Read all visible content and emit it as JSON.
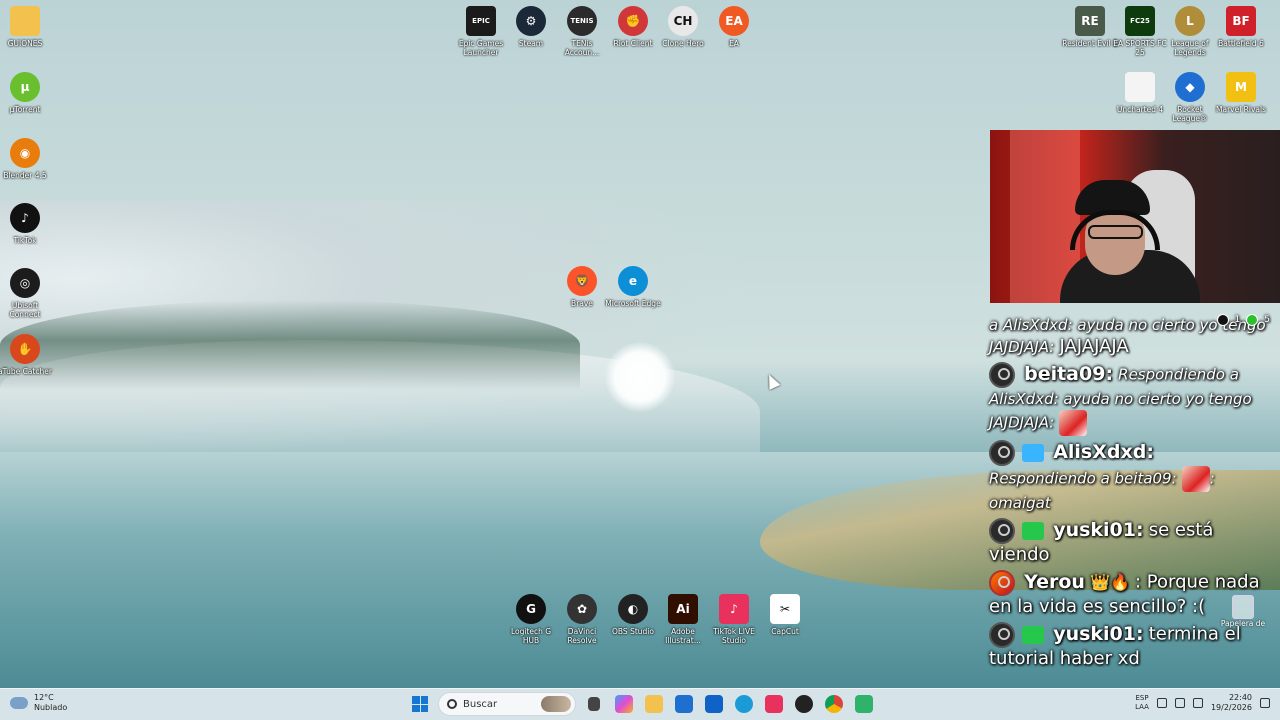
{
  "desktop": {
    "left_icons": [
      {
        "name": "guiones-folder-icon",
        "label": "GUIONES",
        "color": "#f2c14e",
        "glyph": ""
      },
      {
        "name": "utorrent-icon",
        "label": "µTorrent",
        "color": "#6abf2f",
        "glyph": "µ"
      },
      {
        "name": "blender-icon",
        "label": "Blender 4.5",
        "color": "#e87d0d",
        "glyph": "◉"
      },
      {
        "name": "tiktok-icon",
        "label": "TikTok",
        "color": "#111111",
        "glyph": "♪"
      },
      {
        "name": "ubisoft-connect-icon",
        "label": "Ubisoft Connect",
        "color": "#1c1c1c",
        "glyph": "◎"
      },
      {
        "name": "atube-catcher-icon",
        "label": "aTube Catcher",
        "color": "#d9481c",
        "glyph": "✋"
      }
    ],
    "top_icons": [
      {
        "name": "epic-games-icon",
        "label": "Epic Games Launcher",
        "color": "#1b1b1b",
        "glyph": "EPIC"
      },
      {
        "name": "steam-icon",
        "label": "Steam",
        "color": "#1b2838",
        "glyph": "⚙"
      },
      {
        "name": "tenis-icon",
        "label": "TENis Accoun...",
        "color": "#2b2b2b",
        "glyph": "TENIS"
      },
      {
        "name": "riot-client-icon",
        "label": "Riot Client",
        "color": "#d13639",
        "glyph": "✊"
      },
      {
        "name": "clone-hero-icon",
        "label": "Clone Hero",
        "color": "#e8e8e8",
        "glyph": "CH"
      },
      {
        "name": "ea-icon",
        "label": "EA",
        "color": "#f05a22",
        "glyph": "EA"
      }
    ],
    "right_icons": [
      {
        "name": "resident-evil-icon",
        "label": "Resident Evil 2",
        "color": "#4a5a4a",
        "glyph": "RE"
      },
      {
        "name": "ea-sports-fc-icon",
        "label": "EA SPORTS FC 25",
        "color": "#0d3b0d",
        "glyph": "FC25"
      },
      {
        "name": "league-of-legends-icon",
        "label": "League of Legends",
        "color": "#b08d3a",
        "glyph": "L"
      },
      {
        "name": "battlefield-icon",
        "label": "Battlefield 6",
        "color": "#d0202a",
        "glyph": "BF"
      },
      {
        "name": "uncharted-file-icon",
        "label": "Uncharted 4",
        "color": "#f4f4f4",
        "glyph": ""
      },
      {
        "name": "rocket-league-icon",
        "label": "Rocket League®",
        "color": "#1e6fd1",
        "glyph": "◆"
      },
      {
        "name": "marvel-rivals-icon",
        "label": "Marvel Rivals",
        "color": "#f2c012",
        "glyph": "M"
      }
    ],
    "middle_icons": [
      {
        "name": "brave-icon",
        "label": "Brave",
        "color": "#fb542b",
        "glyph": "🦁"
      },
      {
        "name": "microsoft-edge-icon",
        "label": "Microsoft Edge",
        "color": "#0c8fd6",
        "glyph": "e"
      }
    ],
    "bottom_icons": [
      {
        "name": "logitech-ghub-icon",
        "label": "Logitech G HUB",
        "color": "#111111",
        "glyph": "G"
      },
      {
        "name": "davinci-resolve-icon",
        "label": "DaVinci Resolve",
        "color": "#333333",
        "glyph": "✿"
      },
      {
        "name": "obs-studio-icon",
        "label": "OBS Studio",
        "color": "#222222",
        "glyph": "◐"
      },
      {
        "name": "adobe-illustrator-icon",
        "label": "Adobe Illustrat...",
        "color": "#300e00",
        "glyph": "Ai"
      },
      {
        "name": "tiktok-live-studio-icon",
        "label": "TikTok LIVE Studio",
        "color": "#e8315c",
        "glyph": "♪"
      },
      {
        "name": "capcut-icon",
        "label": "CapCut",
        "color": "#ffffff",
        "glyph": "✂"
      }
    ],
    "recycle_bin_label": "Papelera de"
  },
  "chat": {
    "counts": {
      "tiktok": "1",
      "green": "5"
    },
    "messages": [
      {
        "user": "",
        "text": "a AlisXdxd: ayuda no cierto yo tengo JAJDJAJA:",
        "extra": "JAJAJAJA",
        "badge": ""
      },
      {
        "user": "beita09:",
        "text": "Respondiendo a AlisXdxd: ayuda no cierto yo tengo JAJDJAJA:",
        "extra": "",
        "badge": ""
      },
      {
        "user": "AlisXdxd:",
        "text": "Respondiendo a beita09:",
        "extra": "omaigat",
        "badge": "blue"
      },
      {
        "user": "yuski01:",
        "text": "se está viendo",
        "extra": "",
        "badge": "green"
      },
      {
        "user": "Yerou",
        "text": ": Porque nada en la vida es sencillo? :(",
        "extra": "",
        "badge": ""
      },
      {
        "user": "yuski01:",
        "text": "termina el tutorial haber xd",
        "extra": "",
        "badge": "green"
      }
    ]
  },
  "taskbar": {
    "weather_temp": "12°C",
    "weather_desc": "Nublado",
    "search_placeholder": "Buscar",
    "lang": "ESP",
    "lang2": "LAA",
    "time": "22:40",
    "date": "19/2/2026"
  }
}
